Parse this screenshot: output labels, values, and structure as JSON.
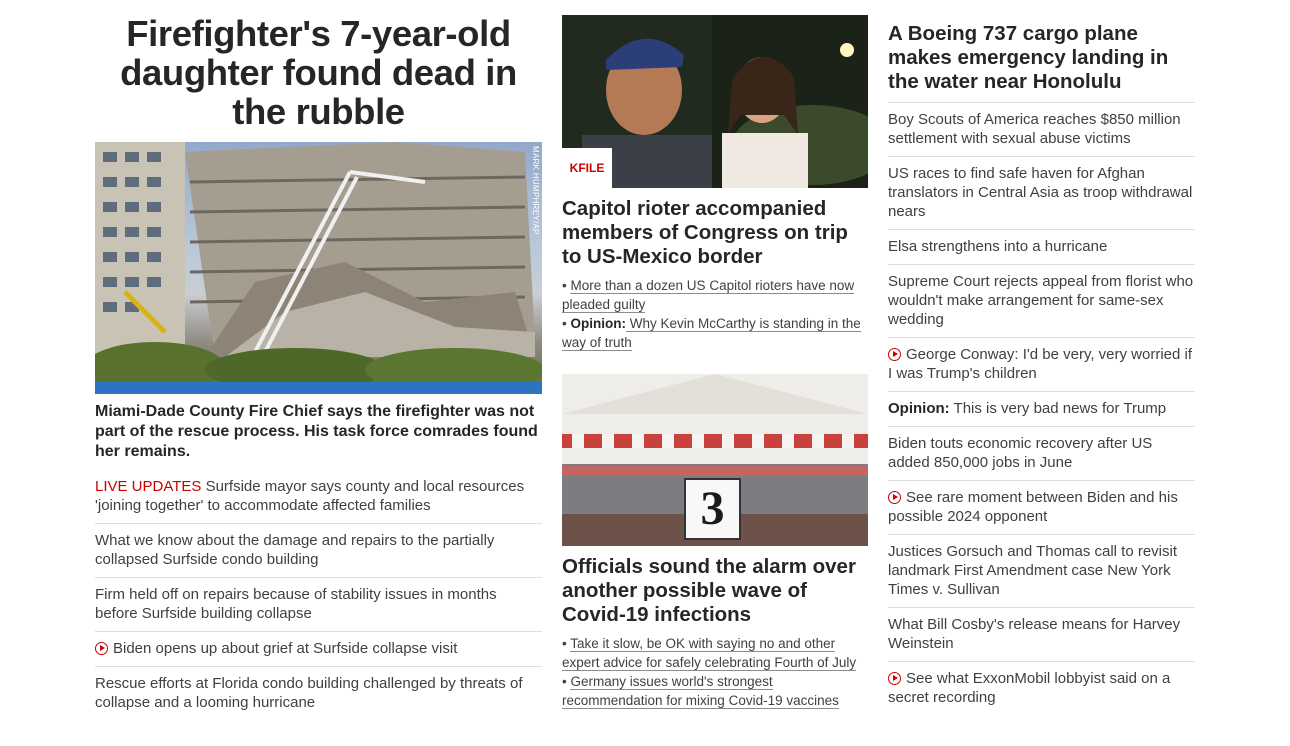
{
  "left": {
    "headline": "Firefighter's 7-year-old daughter found dead in the rubble",
    "image_credit": "MARK HUMPHREY/AP",
    "caption": "Miami-Dade County Fire Chief says the firefighter was not part of the rescue process. His task force comrades found her remains.",
    "live_label": "LIVE UPDATES",
    "live_text": " Surfside mayor says county and local resources 'joining together' to accommodate affected families",
    "links": [
      "What we know about the damage and repairs to the partially collapsed Surfside condo building",
      "Firm held off on repairs because of stability issues in months before Surfside building collapse",
      "Biden opens up about grief at Surfside collapse visit",
      "Rescue efforts at Florida condo building challenged by threats of collapse and a looming hurricane"
    ]
  },
  "middle": {
    "card1": {
      "badge": "KFILE",
      "title": "Capitol rioter accompanied members of Congress on trip to US-Mexico border",
      "bullet1": "More than a dozen US Capitol rioters have now pleaded guilty",
      "bullet2_label": "Opinion:",
      "bullet2": " Why Kevin McCarthy is standing in the way of truth"
    },
    "card2": {
      "sign_number": "3",
      "title": "Officials sound the alarm over another possible wave of Covid-19 infections",
      "bullet1": "Take it slow, be OK with saying no and other expert advice for safely celebrating Fourth of July",
      "bullet2": "Germany issues world's strongest recommendation for mixing Covid-19 vaccines"
    }
  },
  "right": {
    "headline": "A Boeing 737 cargo plane makes emergency landing in the water near Honolulu",
    "links": {
      "l1": "Boy Scouts of America reaches $850 million settlement with sexual abuse victims",
      "l2": "US races to find safe haven for Afghan translators in Central Asia as troop withdrawal nears",
      "l3": "Elsa strengthens into a hurricane",
      "l4": "Supreme Court rejects appeal from florist who wouldn't make arrangement for same-sex wedding",
      "l5": "George Conway: I'd be very, very worried if I was Trump's children",
      "l6_label": "Opinion:",
      "l6": " This is very bad news for Trump",
      "l7": "Biden touts economic recovery after US added 850,000 jobs in June",
      "l8": "See rare moment between Biden and his possible 2024 opponent",
      "l9": "Justices Gorsuch and Thomas call to revisit landmark First Amendment case New York Times v. Sullivan",
      "l10": "What Bill Cosby's release means for Harvey Weinstein",
      "l11": "See what ExxonMobil lobbyist said on a secret recording"
    }
  }
}
